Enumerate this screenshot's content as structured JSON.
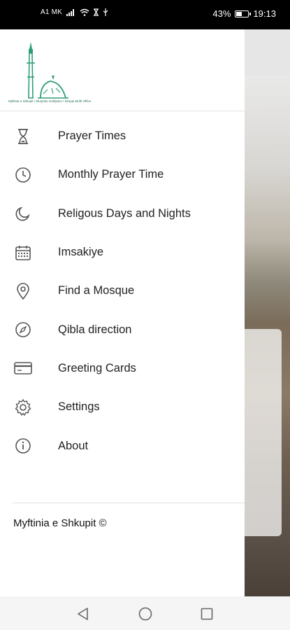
{
  "status_bar": {
    "carrier": "A1 MK",
    "battery": "43%",
    "battery_level": 0.43,
    "time": "19:13",
    "icons": [
      "signal-icon",
      "wifi-icon",
      "hourglass-icon",
      "usb-icon",
      "battery-icon"
    ]
  },
  "drawer": {
    "logo": {
      "text": "Myftinia e Shkupit / Skopsko muftijstvo / Skopje Mufti Office",
      "icon": "mosque-logo-icon",
      "color": "#2e9e78"
    },
    "menu": [
      {
        "label": "Prayer Times",
        "icon": "hourglass-icon"
      },
      {
        "label": "Monthly Prayer Time",
        "icon": "clock-icon"
      },
      {
        "label": "Religous Days and Nights",
        "icon": "moon-icon"
      },
      {
        "label": "Imsakiye",
        "icon": "calendar-icon"
      },
      {
        "label": "Find a Mosque",
        "icon": "location-pin-icon"
      },
      {
        "label": "Qibla direction",
        "icon": "compass-icon"
      },
      {
        "label": "Greeting Cards",
        "icon": "card-icon"
      },
      {
        "label": "Settings",
        "icon": "gear-icon"
      },
      {
        "label": "About",
        "icon": "info-icon"
      }
    ],
    "footer": "Myftinia e Shkupit ©"
  },
  "navigation_bar": {
    "buttons": [
      "back-icon",
      "home-icon",
      "recents-icon"
    ]
  },
  "colors": {
    "icon": "#555555",
    "text": "#222222",
    "accent": "#2e9e78"
  }
}
